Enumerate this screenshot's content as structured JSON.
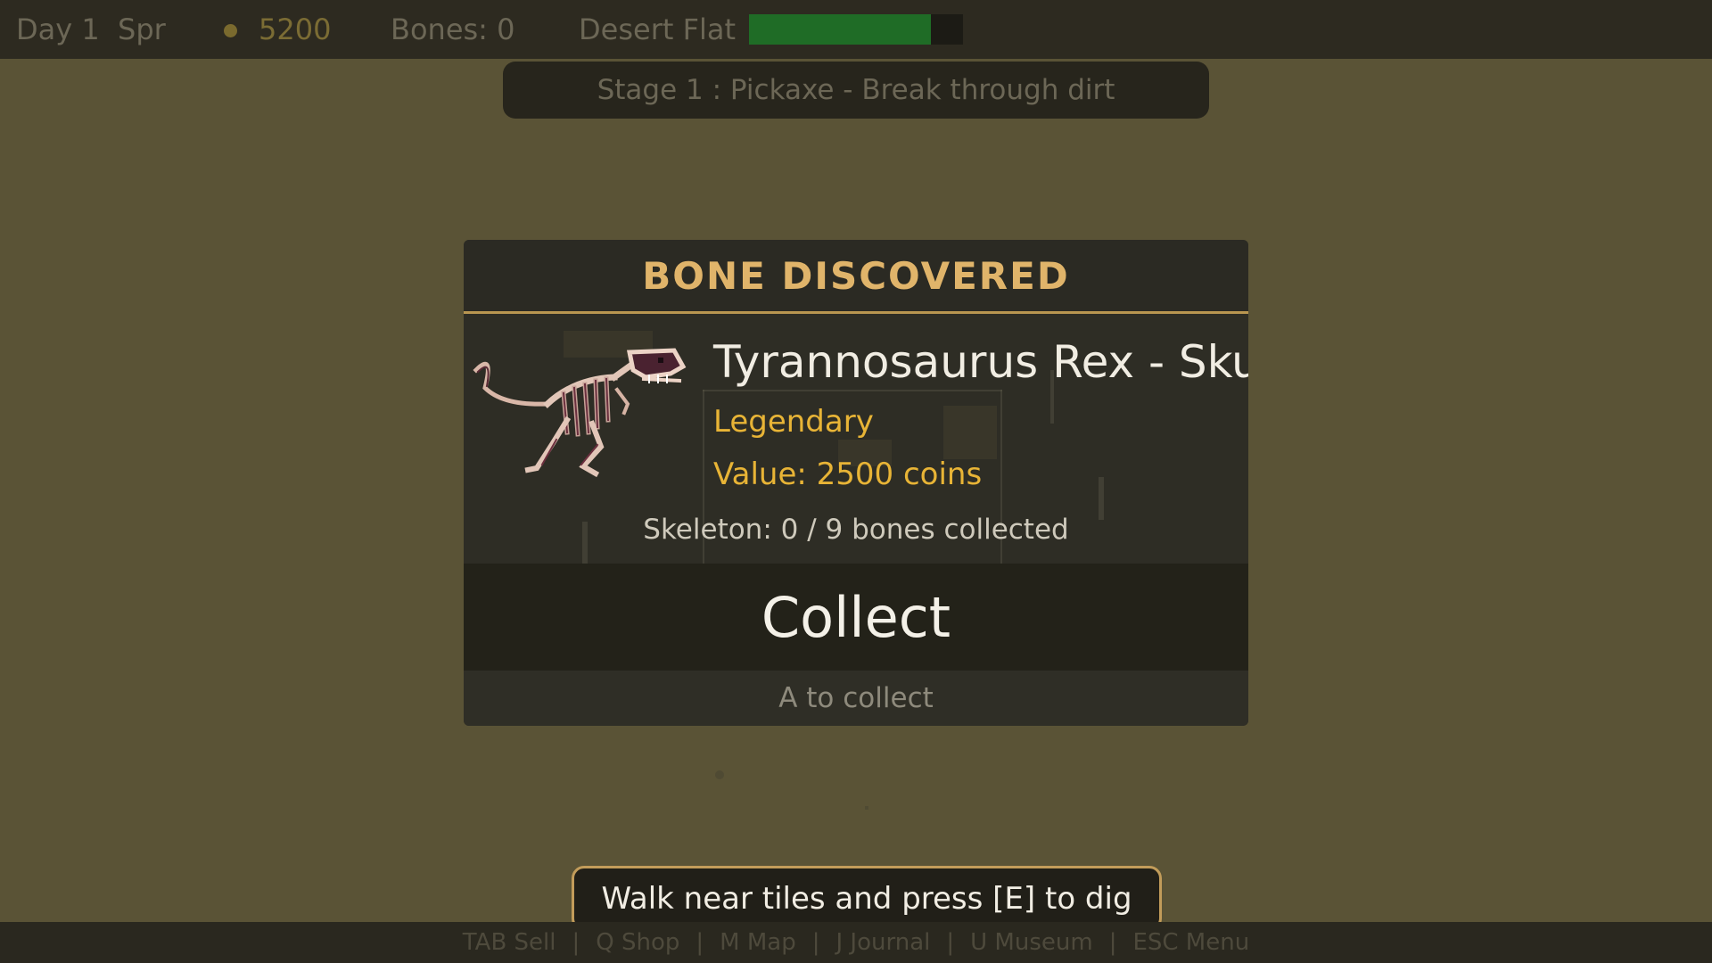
{
  "hud": {
    "day": "Day 1",
    "season": "Spr",
    "coins": "5200",
    "bones": "Bones: 0",
    "location": "Desert Flat",
    "stamina_fraction": 0.85,
    "stamina_color": "#1f6c26"
  },
  "stage_banner": "Stage 1 : Pickaxe - Break through dirt",
  "modal": {
    "title": "BONE DISCOVERED",
    "fossil_icon": "t-rex-skeleton",
    "bone_name": "Tyrannosaurus Rex - Skull",
    "rarity": "Legendary",
    "rarity_color": "#e8b436",
    "value": "Value: 2500 coins",
    "skeleton_progress": "Skeleton: 0 / 9 bones collected",
    "collect_label": "Collect",
    "collect_hint": "A to collect"
  },
  "dig_hint": "Walk near tiles and press [E] to dig",
  "bottom_bar": {
    "items": [
      "TAB Sell",
      "Q Shop",
      "M Map",
      "J Journal",
      "U Museum",
      "ESC Menu"
    ],
    "separator": "|"
  }
}
